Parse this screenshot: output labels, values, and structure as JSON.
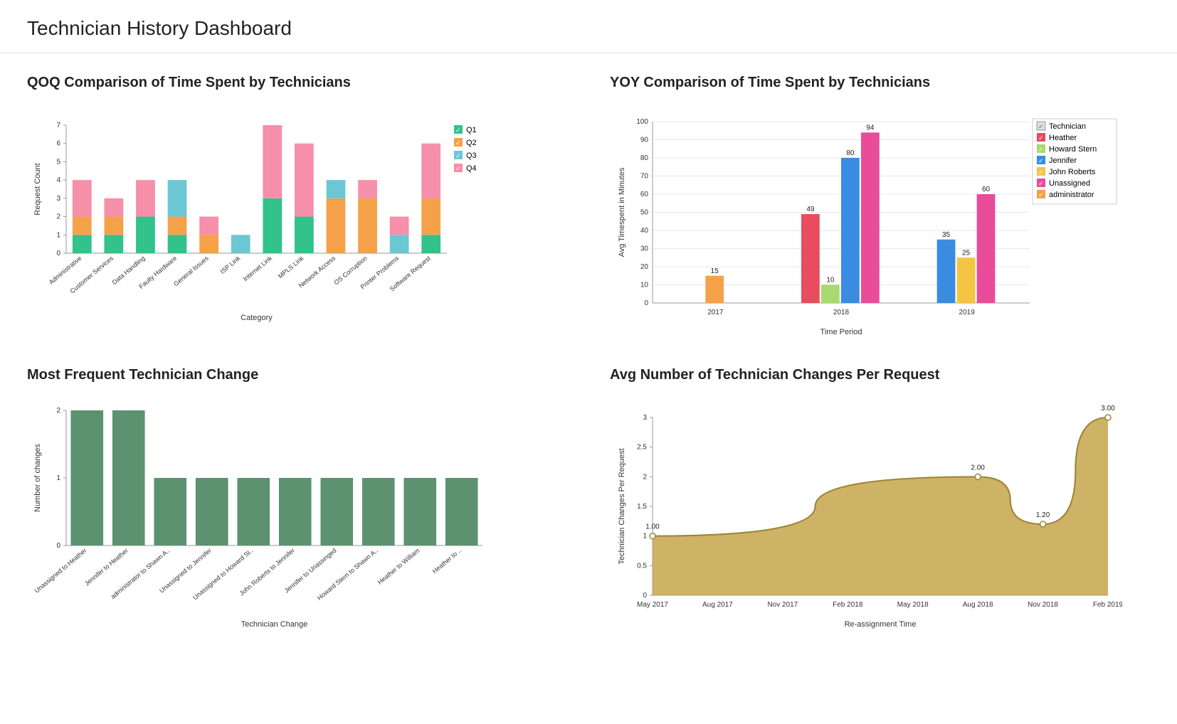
{
  "header": {
    "title": "Technician History Dashboard"
  },
  "panels": {
    "qoq": {
      "title": "QOQ Comparison of Time Spent by Technicians"
    },
    "yoy": {
      "title": "YOY Comparison of Time Spent by Technicians"
    },
    "freq": {
      "title": "Most Frequent Technician Change"
    },
    "avg": {
      "title": "Avg Number of Technician Changes Per Request"
    }
  },
  "colors": {
    "q1": "#33c18c",
    "q2": "#f5a14a",
    "q3": "#6cc7d4",
    "q4": "#f68fa9",
    "heather": "#e84c5e",
    "howard": "#a9d96f",
    "jennifer": "#3a8ce0",
    "john": "#f4c542",
    "unassigned": "#e84c9a",
    "admin": "#f5a14a",
    "techbox": "#ddd",
    "green": "#5c9270",
    "area": "#c6a54b",
    "areaStroke": "#9b8534"
  },
  "chart_data": [
    {
      "id": "qoq",
      "type": "bar",
      "stacked": true,
      "title": "QOQ Comparison of Time Spent by Technicians",
      "xlabel": "Category",
      "ylabel": "Request Count",
      "ylim": [
        0,
        7
      ],
      "categories": [
        "Administrative",
        "Customer Services",
        "Data Handling",
        "Faulty Hardware",
        "General Issues",
        "ISP Link",
        "Internet Link",
        "MPLS Link",
        "Network Access",
        "OS Corruption",
        "Printer Problems",
        "Software Request"
      ],
      "series": [
        {
          "name": "Q1",
          "values": [
            1,
            1,
            2,
            1,
            0,
            0,
            3,
            2,
            0,
            0,
            0,
            1
          ]
        },
        {
          "name": "Q2",
          "values": [
            1,
            1,
            0,
            1,
            1,
            0,
            0,
            0,
            3,
            3,
            0,
            2
          ]
        },
        {
          "name": "Q3",
          "values": [
            0,
            0,
            0,
            2,
            0,
            1,
            0,
            0,
            1,
            0,
            1,
            0
          ]
        },
        {
          "name": "Q4",
          "values": [
            2,
            1,
            2,
            0,
            1,
            0,
            4,
            4,
            0,
            1,
            1,
            3
          ]
        }
      ],
      "legend": [
        "Q1",
        "Q2",
        "Q3",
        "Q4"
      ]
    },
    {
      "id": "yoy",
      "type": "bar",
      "grouped": true,
      "title": "YOY Comparison of Time Spent by Technicians",
      "xlabel": "Time Period",
      "ylabel": "Avg Timespent in Minutes",
      "ylim": [
        0,
        100
      ],
      "categories": [
        "2017",
        "2018",
        "2019"
      ],
      "series": [
        {
          "name": "Heather",
          "values": [
            null,
            49,
            null
          ]
        },
        {
          "name": "Howard Stern",
          "values": [
            null,
            10,
            null
          ]
        },
        {
          "name": "Jennifer",
          "values": [
            null,
            80,
            35
          ]
        },
        {
          "name": "John Roberts",
          "values": [
            null,
            null,
            25
          ]
        },
        {
          "name": "Unassigned",
          "values": [
            null,
            94,
            60
          ]
        },
        {
          "name": "administrator",
          "values": [
            15,
            null,
            null
          ]
        }
      ],
      "legend_header": "Technician",
      "legend": [
        "Heather",
        "Howard Stern",
        "Jennifer",
        "John Roberts",
        "Unassigned",
        "administrator"
      ]
    },
    {
      "id": "freq",
      "type": "bar",
      "title": "Most Frequent Technician Change",
      "xlabel": "Technician Change",
      "ylabel": "Number of changes",
      "ylim": [
        0,
        2
      ],
      "categories": [
        "Unassigned to Heather",
        "Jennifer to Heather",
        "administrator to Shawn A..",
        "Unassigned to Jennifer",
        "Unassigned to Howard St..",
        "John Roberts to Jennifer",
        "Jennifer to Unassinged",
        "Howard Stern to Shawn A..",
        "Heather to William",
        "Heather to .."
      ],
      "values": [
        2,
        2,
        1,
        1,
        1,
        1,
        1,
        1,
        1,
        1
      ]
    },
    {
      "id": "avg",
      "type": "area",
      "title": "Avg Number of Technician Changes Per Request",
      "xlabel": "Re-assignment Time",
      "ylabel": "Technician Changes Per Request",
      "ylim": [
        0,
        3
      ],
      "x_ticks": [
        "May 2017",
        "Aug 2017",
        "Nov 2017",
        "Feb 2018",
        "May 2018",
        "Aug 2018",
        "Nov 2018",
        "Feb 2019"
      ],
      "points": [
        {
          "x": "May 2017",
          "y": 1.0,
          "label": "1.00"
        },
        {
          "x": "Aug 2018",
          "y": 2.0,
          "label": "2.00"
        },
        {
          "x": "Nov 2018",
          "y": 1.2,
          "label": "1.20"
        },
        {
          "x": "Feb 2019",
          "y": 3.0,
          "label": "3.00"
        }
      ]
    }
  ]
}
